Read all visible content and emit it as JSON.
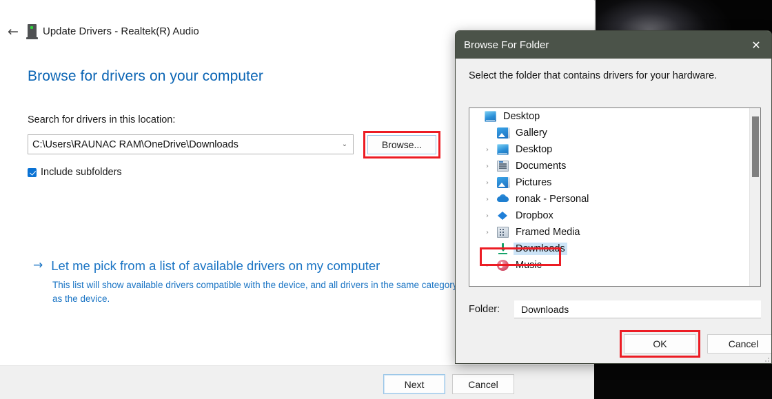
{
  "wizard": {
    "back_icon": "←",
    "device_icon": "device-icon",
    "title": "Update Drivers - Realtek(R) Audio",
    "heading": "Browse for drivers on your computer",
    "search_label": "Search for drivers in this location:",
    "path_value": "C:\\Users\\RAUNAC RAM\\OneDrive\\Downloads",
    "path_chevron": "⌄",
    "browse_label": "Browse...",
    "include_subfolders_label": "Include subfolders",
    "include_subfolders_checked": true,
    "pick_arrow": "→",
    "pick_link": "Let me pick from a list of available drivers on my computer",
    "pick_desc": "This list will show available drivers compatible with the device, and all drivers in the same category as the device.",
    "next_label": "Next",
    "cancel_label": "Cancel",
    "link_color": "#1a74c4",
    "heading_color": "#0a64b4"
  },
  "background": {
    "close_icon": "✕"
  },
  "dialog": {
    "title": "Browse For Folder",
    "close_icon": "✕",
    "prompt": "Select the folder that contains drivers for your hardware.",
    "titlebar_color": "#4b5349",
    "tree": [
      {
        "label": "Desktop",
        "icon": "monitor-icon",
        "indent": 0,
        "expander": "",
        "selected": false
      },
      {
        "label": "Gallery",
        "icon": "gallery-icon",
        "indent": 1,
        "expander": "",
        "selected": false
      },
      {
        "label": "Desktop",
        "icon": "monitor-icon",
        "indent": 1,
        "expander": "›",
        "selected": false
      },
      {
        "label": "Documents",
        "icon": "documents-icon",
        "indent": 1,
        "expander": "›",
        "selected": false
      },
      {
        "label": "Pictures",
        "icon": "pictures-icon",
        "indent": 1,
        "expander": "›",
        "selected": false
      },
      {
        "label": "ronak - Personal",
        "icon": "onedrive-icon",
        "indent": 1,
        "expander": "›",
        "selected": false
      },
      {
        "label": "Dropbox",
        "icon": "dropbox-icon",
        "indent": 1,
        "expander": "›",
        "selected": false
      },
      {
        "label": "Framed Media",
        "icon": "building-icon",
        "indent": 1,
        "expander": "›",
        "selected": false
      },
      {
        "label": "Downloads",
        "icon": "download-icon",
        "indent": 1,
        "expander": "",
        "selected": true
      },
      {
        "label": "Music",
        "icon": "music-icon",
        "indent": 1,
        "expander": "›",
        "selected": false
      }
    ],
    "folder_label": "Folder:",
    "folder_value": "Downloads",
    "ok_label": "OK",
    "cancel_label": "Cancel",
    "highlight_color": "#ec1c24",
    "selection_color": "#cce4f7"
  }
}
